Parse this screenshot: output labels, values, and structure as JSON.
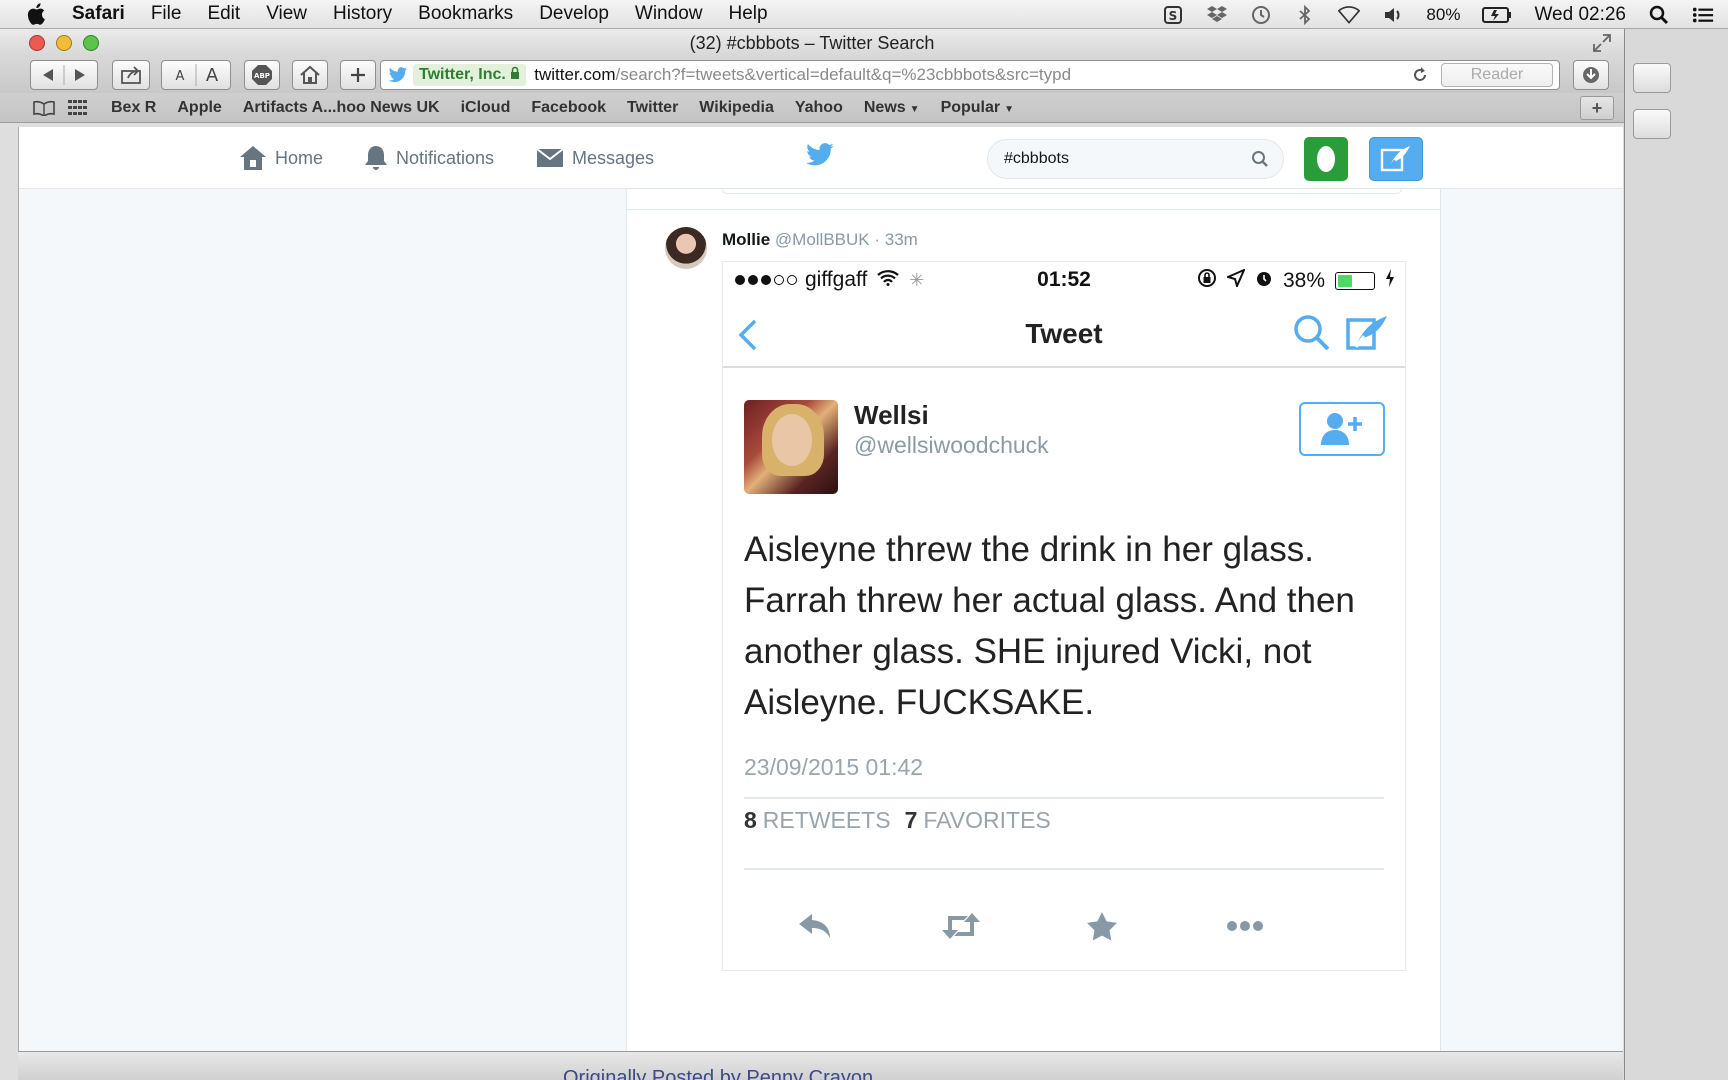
{
  "menubar": {
    "app": "Safari",
    "items": [
      "File",
      "Edit",
      "View",
      "History",
      "Bookmarks",
      "Develop",
      "Window",
      "Help"
    ],
    "battery": "80%",
    "clock": "Wed 02:26"
  },
  "window": {
    "title": "(32) #cbbbots – Twitter Search",
    "ev_badge": "Twitter, Inc.",
    "url_host": "twitter.com",
    "url_path": "/search?f=tweets&vertical=default&q=%23cbbbots&src=typd",
    "reader": "Reader"
  },
  "bookmarks": [
    "Bex R",
    "Apple",
    "Artifacts A...hoo News UK",
    "iCloud",
    "Facebook",
    "Twitter",
    "Wikipedia",
    "Yahoo",
    "News",
    "Popular"
  ],
  "twitter_nav": {
    "home": "Home",
    "notifications": "Notifications",
    "messages": "Messages",
    "search_value": "#cbbbots",
    "brand_color": "#55acee"
  },
  "tweet": {
    "author_name": "Mollie",
    "author_handle": "@MollBBUK",
    "age": "· 33m"
  },
  "phone_screenshot": {
    "carrier": "giffgaff",
    "time": "01:52",
    "battery": "38%",
    "battery_level": 0.38,
    "nav_title": "Tweet",
    "user_name": "Wellsi",
    "user_handle": "@wellsiwoodchuck",
    "text": "Aisleyne threw the drink in her glass. Farrah threw her actual glass. And then another glass. SHE injured Vicki, not Aisleyne. FUCKSAKE.",
    "date": "23/09/2015 01:42",
    "retweets_count": "8",
    "retweets_label": "RETWEETS",
    "favorites_count": "7",
    "favorites_label": "FAVORITES"
  },
  "statusbar": {
    "peek_text": "Originally Posted by Penny Crayon"
  }
}
